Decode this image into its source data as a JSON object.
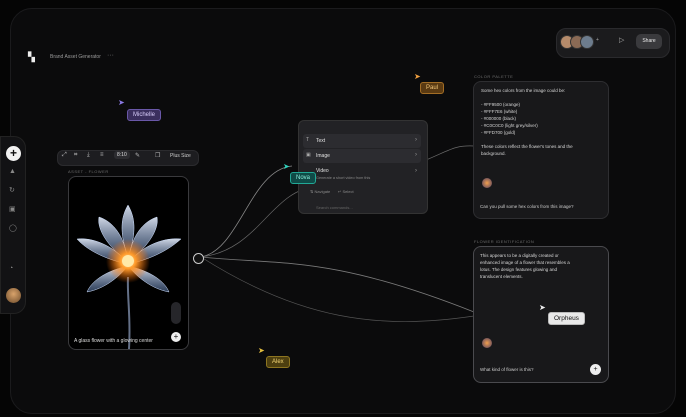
{
  "app": {
    "title": "Brand Asset Generator",
    "more_icon": "ellipsis-icon"
  },
  "header": {
    "share_label": "Share"
  },
  "left_toolbar": {
    "icons": [
      "plus-icon",
      "triangle-icon",
      "refresh-icon",
      "image-icon",
      "chat-icon",
      "clock-icon",
      "avatar"
    ]
  },
  "image_toolbar": {
    "zoom": "8:10",
    "plus_label": "Plus Size"
  },
  "image_node": {
    "label": "ASSET - FLOWER",
    "caption": "A glass flower with a glowing center"
  },
  "menu": {
    "label": "TURN INTO",
    "items": [
      {
        "label": "Text"
      },
      {
        "label": "Image"
      },
      {
        "label": "Video",
        "sub": "Generate a short video from this"
      }
    ],
    "foot_left": "⇅ Navigate",
    "foot_right": "↵ Select",
    "search_placeholder": "Search commands..."
  },
  "palette": {
    "label": "COLOR PALETTE",
    "intro": "Some hex colors from the image could be:",
    "colors": [
      "- #FF9500 (orange)",
      "- #FFF7E6 (white)",
      "- #000000 (black)",
      "- #C0C0C0 (light grey/silver)",
      "- #FFD700 (gold)"
    ],
    "outro_1": "These colors reflect the flower's tones and the",
    "outro_2": "background.",
    "prompt": "Can you pull some hex colors from this image?"
  },
  "identification": {
    "label": "FLOWER IDENTIFICATION",
    "lines": [
      "This appears to be a digitally created or",
      "enhanced image of a flower that resembles a",
      "lotus. The design features glowing and",
      "translucent elements."
    ],
    "prompt": "What kind of flower is this?"
  },
  "cursors": {
    "michelle": "Michelle",
    "paul": "Paul",
    "nova": "Nova",
    "alex": "Alex",
    "orpheus": "Orpheus"
  },
  "colors": {
    "michelle": "#8c7ae6",
    "paul": "#f0a040",
    "nova": "#2fd3bd",
    "alex": "#e5c040"
  }
}
